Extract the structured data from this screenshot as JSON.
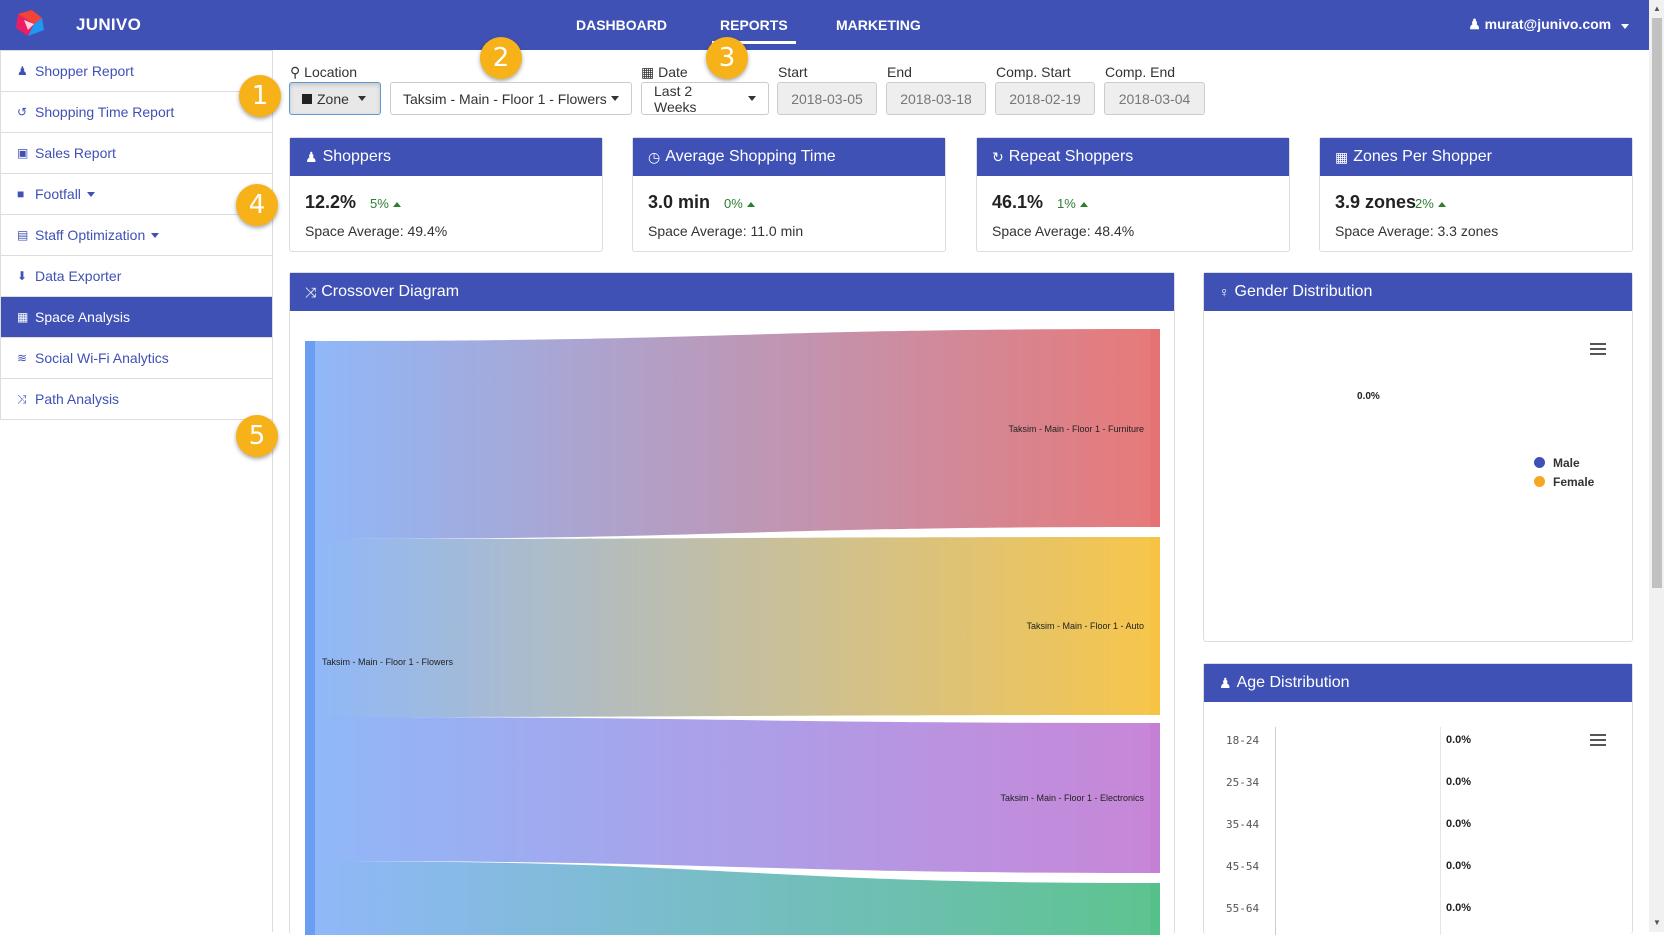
{
  "app": {
    "brand": "JUNIVO"
  },
  "nav": {
    "items": [
      "DASHBOARD",
      "REPORTS",
      "MARKETING"
    ],
    "active": "REPORTS",
    "user": "murat@junivo.com"
  },
  "sidebar": {
    "items": [
      {
        "label": "Shopper Report",
        "icon": "users-icon"
      },
      {
        "label": "Shopping Time Report",
        "icon": "history-icon"
      },
      {
        "label": "Sales Report",
        "icon": "money-icon"
      },
      {
        "label": "Footfall",
        "icon": "video-camera-icon"
      },
      {
        "label": "Staff Optimization",
        "icon": "id-card-icon"
      },
      {
        "label": "Data Exporter",
        "icon": "download-icon"
      },
      {
        "label": "Space Analysis",
        "icon": "th-large-icon"
      },
      {
        "label": "Social Wi-Fi Analytics",
        "icon": "wifi-icon"
      },
      {
        "label": "Path Analysis",
        "icon": "random-icon"
      }
    ]
  },
  "badges": [
    "1",
    "2",
    "3",
    "4",
    "5"
  ],
  "filters": {
    "location_label": "Location",
    "zone_value": "Zone",
    "zone_select": "Taksim - Main - Floor 1 - Flowers",
    "date_label": "Date",
    "date_range": "Last 2 Weeks",
    "start_label": "Start",
    "start": "2018-03-05",
    "end_label": "End",
    "end": "2018-03-18",
    "comp_start_label": "Comp. Start",
    "comp_start": "2018-02-19",
    "comp_end_label": "Comp. End",
    "comp_end": "2018-03-04"
  },
  "kpis": [
    {
      "title": "Shoppers",
      "value": "12.2%",
      "delta": "5%",
      "avg": "Space Average: 49.4%"
    },
    {
      "title": "Average Shopping Time",
      "value": "3.0 min",
      "delta": "0%",
      "avg": "Space Average: 11.0 min"
    },
    {
      "title": "Repeat Shoppers",
      "value": "46.1%",
      "delta": "1%",
      "avg": "Space Average: 48.4%"
    },
    {
      "title": "Zones Per Shopper",
      "value": "3.9 zones",
      "delta": "2%",
      "avg": "Space Average: 3.3 zones"
    }
  ],
  "crossover": {
    "title": "Crossover Diagram",
    "source": "Taksim - Main - Floor 1 - Flowers",
    "targets": [
      {
        "label": "Taksim - Main - Floor 1 - Furniture",
        "color": "#e57373"
      },
      {
        "label": "Taksim - Main - Floor 1 - Auto",
        "color": "#f6c343"
      },
      {
        "label": "Taksim - Main - Floor 1 - Electronics",
        "color": "#c580d6"
      },
      {
        "label": "",
        "color": "#55c08a"
      }
    ],
    "source_color": "#7fb0f6"
  },
  "gender": {
    "title": "Gender Distribution",
    "center_label": "0.0%",
    "legend": [
      {
        "name": "Male",
        "color": "#3f51b5"
      },
      {
        "name": "Female",
        "color": "#f5a623"
      }
    ]
  },
  "age": {
    "title": "Age Distribution",
    "rows": [
      {
        "label": "18-24",
        "value": "0.0%"
      },
      {
        "label": "25-34",
        "value": "0.0%"
      },
      {
        "label": "35-44",
        "value": "0.0%"
      },
      {
        "label": "45-54",
        "value": "0.0%"
      },
      {
        "label": "55-64",
        "value": "0.0%"
      }
    ]
  }
}
